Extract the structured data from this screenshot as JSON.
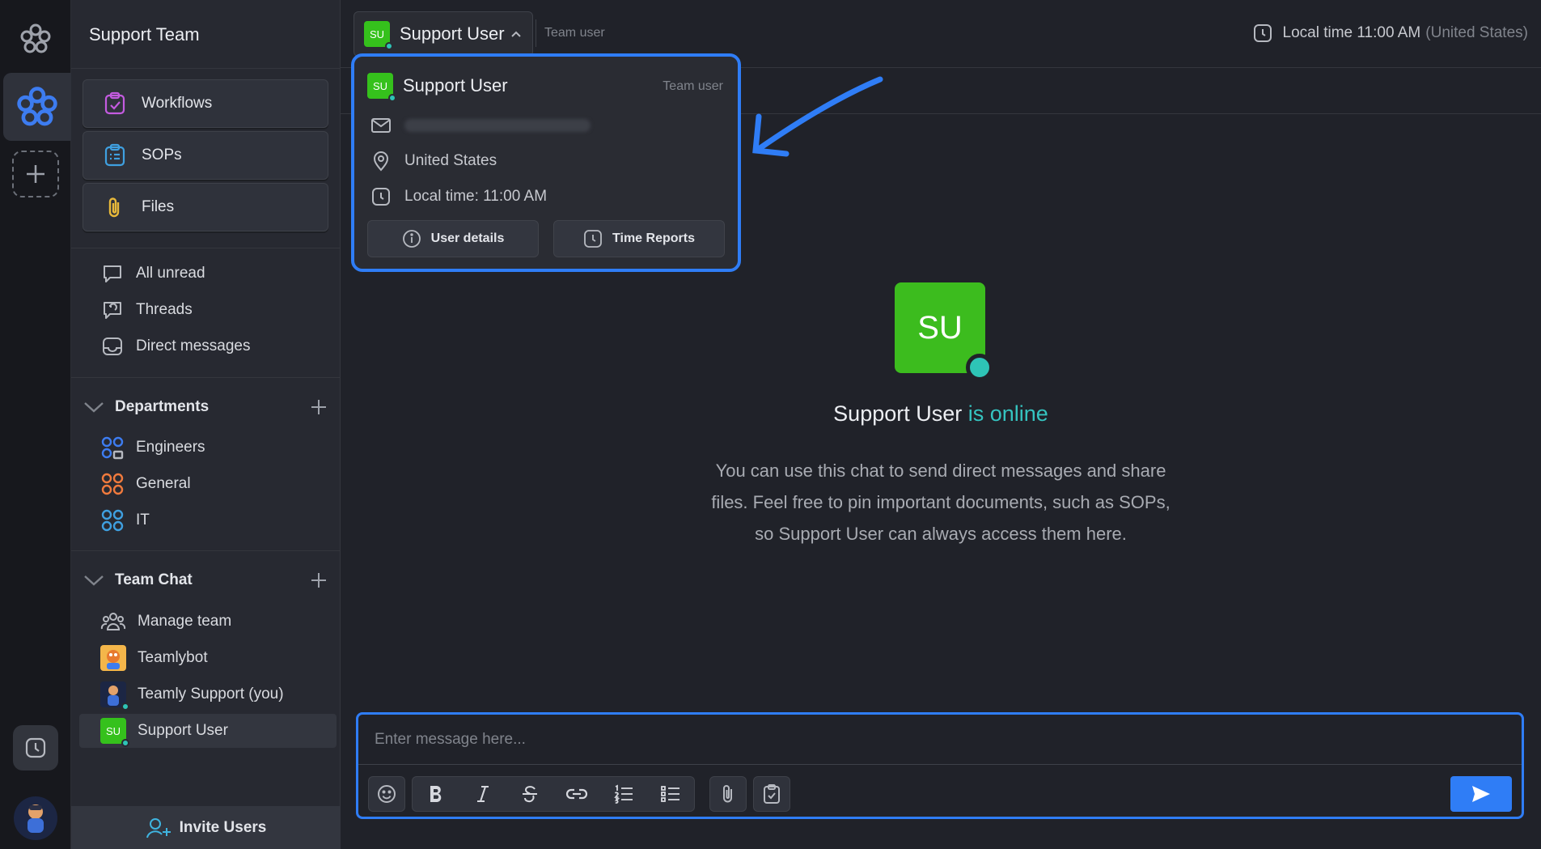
{
  "sidebar": {
    "team_name": "Support Team",
    "big_buttons": [
      {
        "label": "Workflows",
        "icon": "workflow-icon"
      },
      {
        "label": "SOPs",
        "icon": "sop-icon"
      },
      {
        "label": "Files",
        "icon": "paperclip-icon"
      }
    ],
    "nav": [
      {
        "label": "All unread",
        "icon": "chat-bubble-icon"
      },
      {
        "label": "Threads",
        "icon": "threads-icon"
      },
      {
        "label": "Direct messages",
        "icon": "inbox-icon"
      }
    ],
    "departments": {
      "title": "Departments",
      "items": [
        {
          "label": "Engineers",
          "icon": "department-lock-icon",
          "color": "#3d7cf0"
        },
        {
          "label": "General",
          "icon": "department-icon",
          "color": "#f07a3d"
        },
        {
          "label": "IT",
          "icon": "department-icon",
          "color": "#3fa0e0"
        }
      ]
    },
    "team_chat": {
      "title": "Team Chat",
      "items": [
        {
          "label": "Manage team",
          "icon": "people-icon"
        },
        {
          "label": "Teamlybot",
          "icon": "bot-avatar"
        },
        {
          "label": "Teamly Support (you)",
          "icon": "support-avatar"
        },
        {
          "label": "Support User",
          "initials": "SU"
        }
      ]
    },
    "invite_label": "Invite Users"
  },
  "header": {
    "user_name": "Support User",
    "initials": "SU",
    "role": "Team user",
    "local_time_label": "Local time 11:00 AM",
    "local_time_region": "(United States)"
  },
  "popup": {
    "name": "Support User",
    "initials": "SU",
    "role": "Team user",
    "location": "United States",
    "local_time": "Local time: 11:00 AM",
    "user_details_label": "User details",
    "time_reports_label": "Time Reports"
  },
  "main": {
    "initials": "SU",
    "user_name": "Support User",
    "status": "is online",
    "description_lines": [
      "You can use this chat to send direct messages and share",
      "files. Feel free to pin important documents, such as SOPs,",
      "so Support User can always access them here."
    ]
  },
  "composer": {
    "placeholder": "Enter message here..."
  },
  "colors": {
    "accent": "#2f7df6",
    "online": "#2ec4b6",
    "avatar_green": "#35c11c"
  }
}
